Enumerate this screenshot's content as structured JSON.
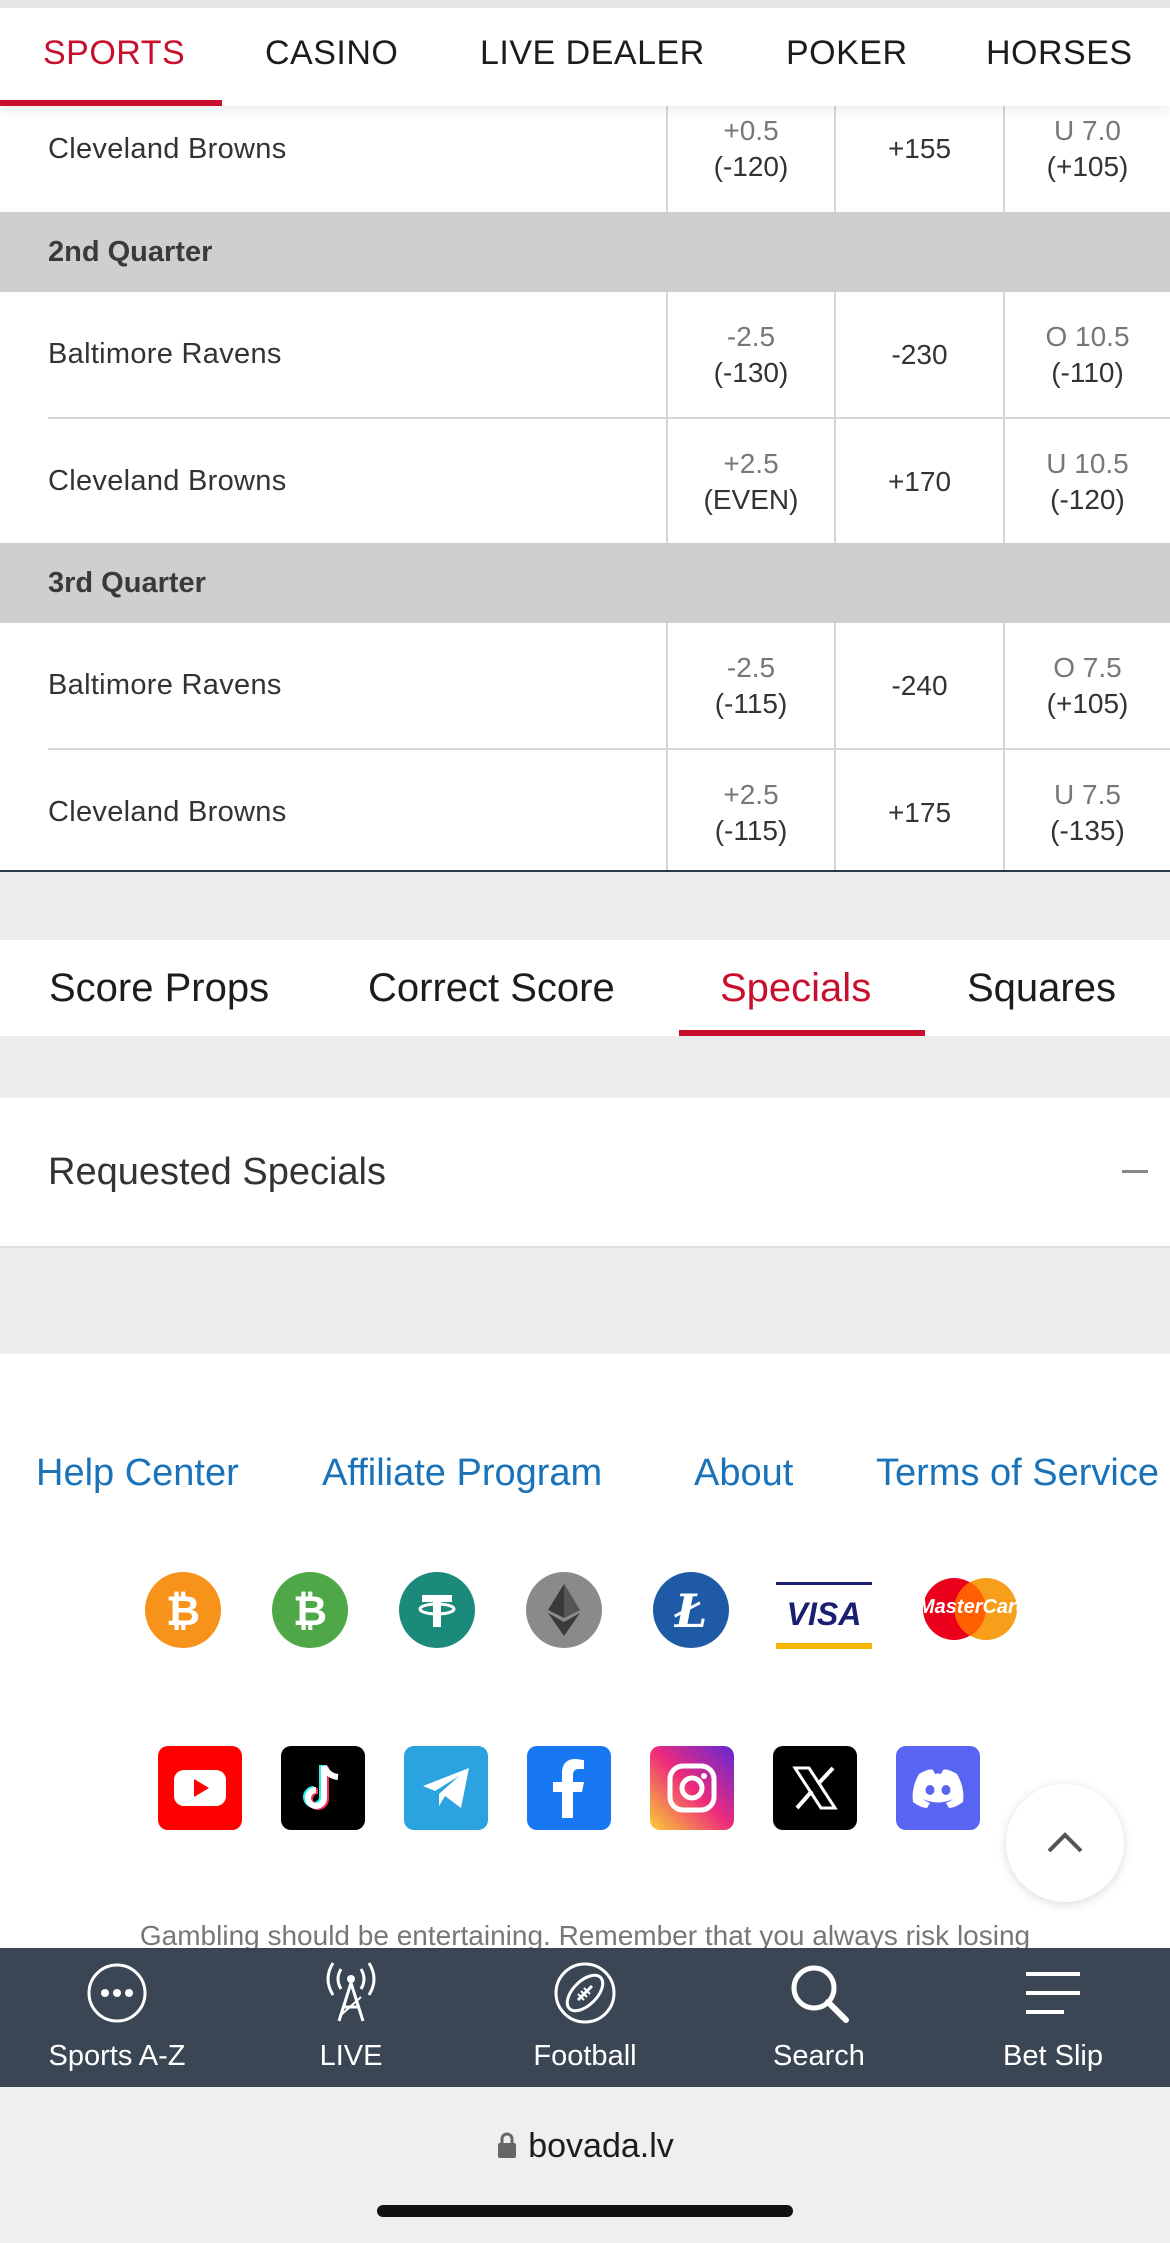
{
  "top_nav": [
    "SPORTS",
    "CASINO",
    "LIVE DEALER",
    "POKER",
    "HORSES"
  ],
  "odds": {
    "first_partial_row": {
      "team": "Cleveland Browns",
      "spread": "+0.5",
      "spread_odds": "(-120)",
      "moneyline": "+155",
      "total": "U 7.0",
      "total_odds": "(+105)"
    },
    "sections": [
      {
        "title": "2nd Quarter",
        "rows": [
          {
            "team": "Baltimore Ravens",
            "spread": "-2.5",
            "spread_odds": "(-130)",
            "moneyline": "-230",
            "total": "O 10.5",
            "total_odds": "(-110)"
          },
          {
            "team": "Cleveland Browns",
            "spread": "+2.5",
            "spread_odds": "(EVEN)",
            "moneyline": "+170",
            "total": "U 10.5",
            "total_odds": "(-120)"
          }
        ]
      },
      {
        "title": "3rd Quarter",
        "rows": [
          {
            "team": "Baltimore Ravens",
            "spread": "-2.5",
            "spread_odds": "(-115)",
            "moneyline": "-240",
            "total": "O 7.5",
            "total_odds": "(+105)"
          },
          {
            "team": "Cleveland Browns",
            "spread": "+2.5",
            "spread_odds": "(-115)",
            "moneyline": "+175",
            "total": "U 7.5",
            "total_odds": "(-135)"
          }
        ]
      }
    ]
  },
  "market_tabs": [
    "Score Props",
    "Correct Score",
    "Specials",
    "Squares"
  ],
  "specials_section": {
    "title": "Requested Specials"
  },
  "footer": {
    "links": [
      "Help Center",
      "Affiliate Program",
      "About",
      "Terms of Service"
    ],
    "payment_icons": [
      "bitcoin-icon",
      "bitcoin-cash-icon",
      "tether-icon",
      "ethereum-icon",
      "litecoin-icon",
      "visa-icon",
      "mastercard-icon"
    ],
    "visa_text": "VISA",
    "mastercard_text": "MasterCard",
    "social_icons": [
      "youtube-icon",
      "tiktok-icon",
      "telegram-icon",
      "facebook-icon",
      "instagram-icon",
      "x-icon",
      "discord-icon"
    ],
    "disclaimer": "Gambling should be entertaining. Remember that you always risk losing"
  },
  "bottom_nav": [
    "Sports A-Z",
    "LIVE",
    "Football",
    "Search",
    "Bet Slip"
  ],
  "browser": {
    "url": "bovada.lv"
  },
  "colors": {
    "accent": "#c8102e",
    "link": "#1a73b8",
    "bottom_bar": "#3b4654",
    "section_header": "#cfcfcf"
  }
}
